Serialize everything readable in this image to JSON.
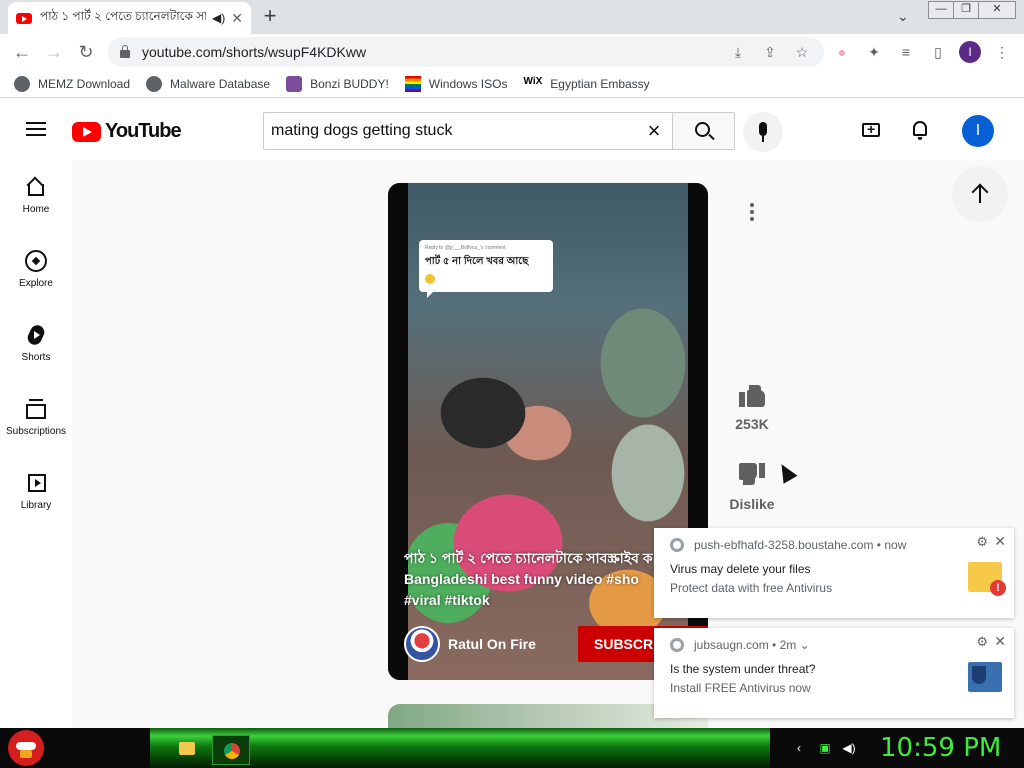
{
  "browser": {
    "tab_title": "পাঠ ১ পার্ট ২ পেতে চ্যানেলটাকে সা",
    "audio_icon": "speaker-icon",
    "url": "youtube.com/shorts/wsupF4KDKww",
    "window_controls": [
      "minimize",
      "maximize",
      "close"
    ],
    "profile_initial": "I",
    "bookmarks": [
      {
        "label": "MEMZ Download",
        "icon": "globe-icon"
      },
      {
        "label": "Malware Database",
        "icon": "globe-icon"
      },
      {
        "label": "Bonzi BUDDY!",
        "icon": "bonzi-icon"
      },
      {
        "label": "Windows ISOs",
        "icon": "rainbow-flag-icon"
      },
      {
        "label": "Egyptian Embassy",
        "icon": "wix-icon",
        "icon_text": "WiX"
      }
    ]
  },
  "youtube": {
    "logo_text": "YouTube",
    "search_query": "mating dogs getting stuck",
    "avatar_initial": "I",
    "guide": [
      {
        "label": "Home",
        "icon": "home-icon"
      },
      {
        "label": "Explore",
        "icon": "compass-icon"
      },
      {
        "label": "Shorts",
        "icon": "shorts-icon"
      },
      {
        "label": "Subscriptions",
        "icon": "subscriptions-icon"
      },
      {
        "label": "Library",
        "icon": "library-icon"
      }
    ],
    "short": {
      "reply_header": "Reply to @p___Bolfvcu_'s comment",
      "reply_text": "পার্ট ৫ না দিলে খবর আছে",
      "title": "পাঠ ১ পার্ট ২ পেতে চ্যানেলটাকে সাবস্ক্রাইব ক\nBangladeshi best funny video #sho\n#viral #tiktok",
      "channel_name": "Ratul On Fire",
      "subscribe_label": "SUBSCRI",
      "likes": "253K",
      "dislike_label": "Dislike"
    }
  },
  "notifications": [
    {
      "source": "push-ebfhafd-3258.boustahe.com",
      "time": "now",
      "title": "Virus may delete your files",
      "body": "Protect data with free Antivirus",
      "image": "folder-warning-icon"
    },
    {
      "source": "jubsaugn.com",
      "time": "2m",
      "title": "Is the system under threat?",
      "body": "Install FREE Antivirus now",
      "image": "shield-computer-icon"
    }
  ],
  "taskbar": {
    "clock": "10:59 PM",
    "colors": {
      "accent": "#3dea3d",
      "bar": "#0f7a10"
    }
  }
}
